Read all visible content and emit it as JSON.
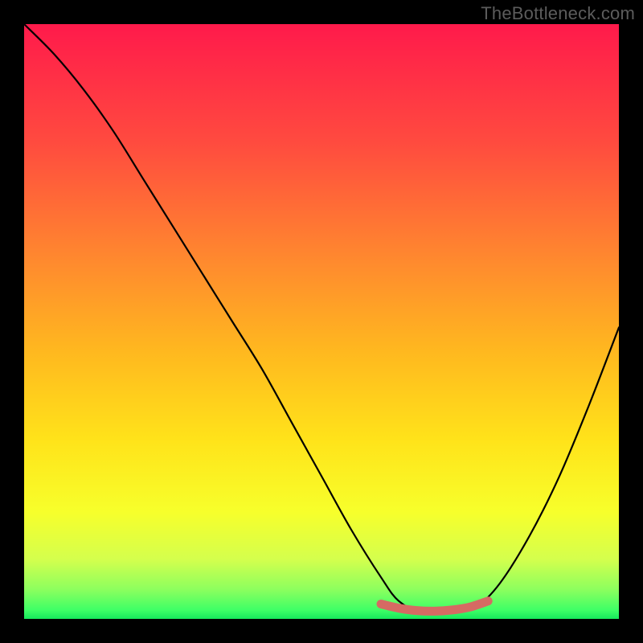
{
  "watermark": "TheBottleneck.com",
  "chart_data": {
    "type": "line",
    "title": "",
    "xlabel": "",
    "ylabel": "",
    "xlim": [
      0,
      100
    ],
    "ylim": [
      0,
      100
    ],
    "series": [
      {
        "name": "bottleneck-curve",
        "x": [
          0,
          5,
          10,
          15,
          20,
          25,
          30,
          35,
          40,
          45,
          50,
          55,
          60,
          63,
          67,
          72,
          76,
          80,
          85,
          90,
          95,
          100
        ],
        "y": [
          100,
          95,
          89,
          82,
          74,
          66,
          58,
          50,
          42,
          33,
          24,
          15,
          7,
          3,
          1,
          1,
          2,
          6,
          14,
          24,
          36,
          49
        ]
      },
      {
        "name": "optimal-zone",
        "x": [
          60,
          63,
          66,
          69,
          72,
          75,
          78
        ],
        "y": [
          2.5,
          1.8,
          1.4,
          1.3,
          1.5,
          2.0,
          3.0
        ]
      }
    ],
    "gradient_stops": [
      {
        "offset": 0.0,
        "color": "#ff1a4b"
      },
      {
        "offset": 0.2,
        "color": "#ff4b3f"
      },
      {
        "offset": 0.4,
        "color": "#ff8a2e"
      },
      {
        "offset": 0.55,
        "color": "#ffb81f"
      },
      {
        "offset": 0.7,
        "color": "#ffe31a"
      },
      {
        "offset": 0.82,
        "color": "#f7ff2b"
      },
      {
        "offset": 0.9,
        "color": "#d4ff4d"
      },
      {
        "offset": 0.95,
        "color": "#8dff5e"
      },
      {
        "offset": 0.985,
        "color": "#3fff66"
      },
      {
        "offset": 1.0,
        "color": "#16e85c"
      }
    ],
    "colors": {
      "curve": "#000000",
      "optimal_zone": "#d66a63"
    }
  }
}
